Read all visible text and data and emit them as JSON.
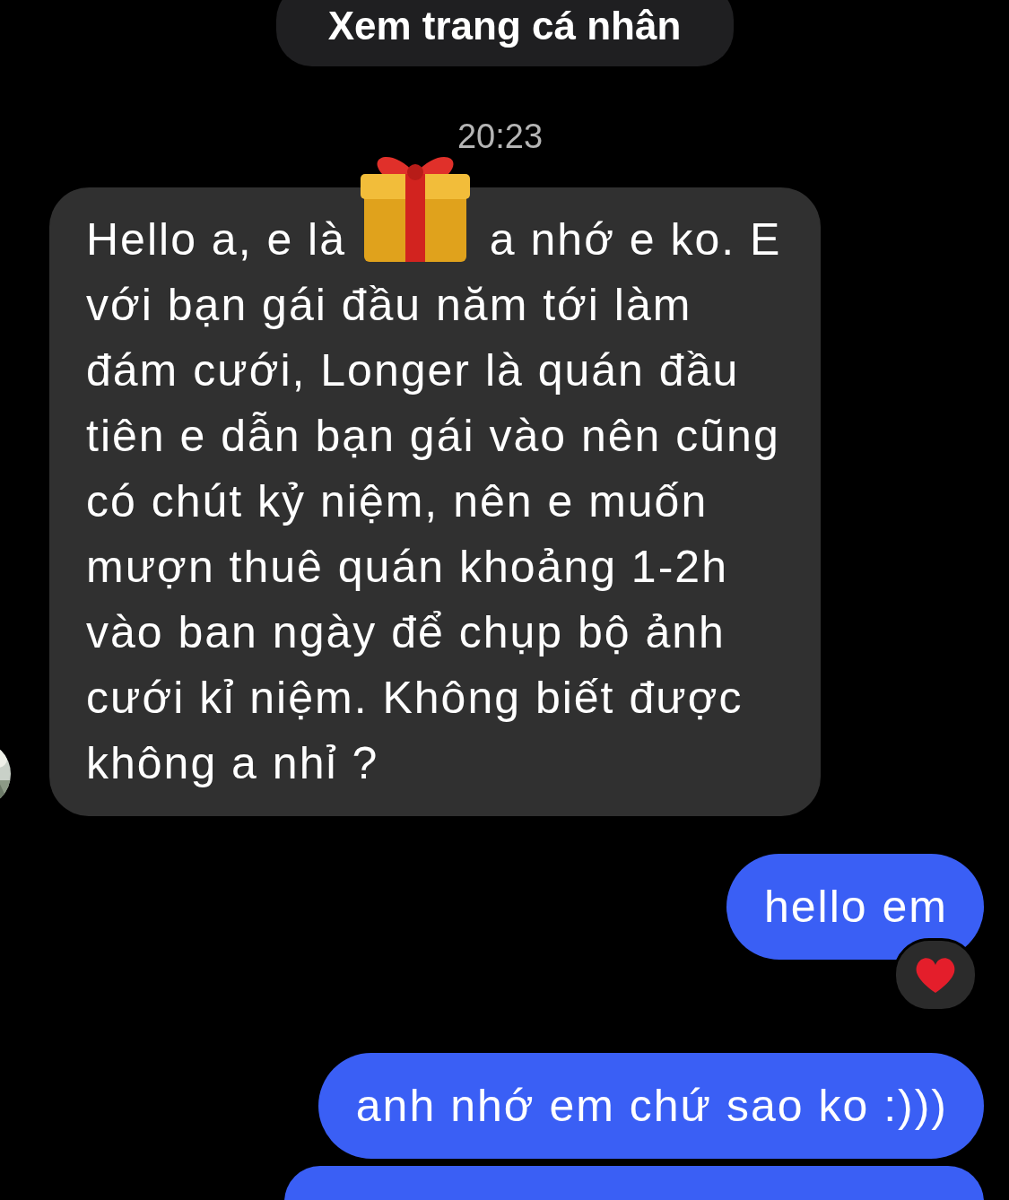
{
  "profile_button": "Xem trang cá nhân",
  "timestamp": "20:23",
  "messages": [
    {
      "kind": "incoming",
      "avatar": true,
      "text_before_sticker": "Hello a, e là",
      "sticker": true,
      "text": "a nhớ e ko. E với bạn gái đầu năm tới làm đám cưới, Longer là quán đầu tiên e dẫn bạn gái vào nên cũng có chút kỷ niệm, nên e muốn mượn thuê quán khoảng 1-2h vào ban ngày để chụp bộ ảnh cưới kỉ niệm. Không biết được không a nhỉ ?"
    },
    {
      "kind": "outgoing",
      "text": "hello em",
      "reacted": true
    },
    {
      "kind": "outgoing",
      "text": "anh nhớ em chứ sao ko :)))",
      "reacted": false
    },
    {
      "kind": "outgoing",
      "reacted": false
    }
  ]
}
